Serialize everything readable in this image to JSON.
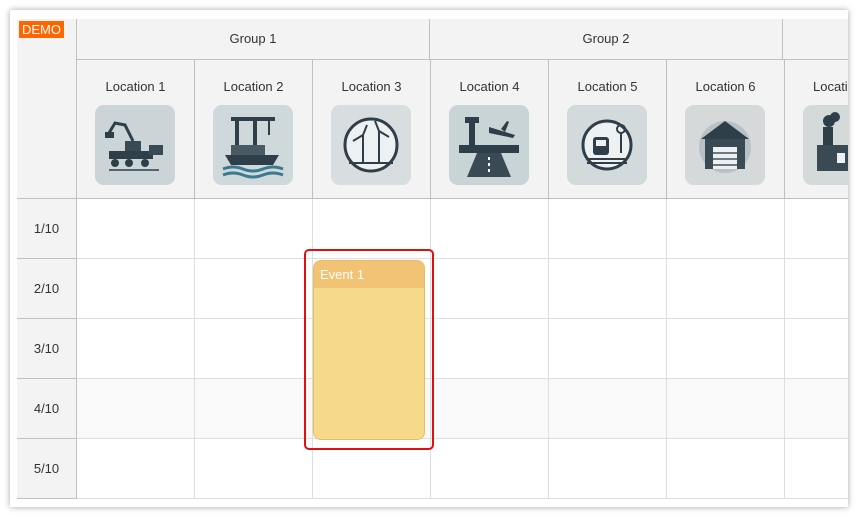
{
  "demo_badge": "DEMO",
  "groups": [
    {
      "name": "Group 1"
    },
    {
      "name": "Group 2"
    }
  ],
  "locations": [
    {
      "name": "Location 1",
      "icon": "excavator-icon"
    },
    {
      "name": "Location 2",
      "icon": "harbor-crane-icon"
    },
    {
      "name": "Location 3",
      "icon": "wind-turbines-icon"
    },
    {
      "name": "Location 4",
      "icon": "airport-icon"
    },
    {
      "name": "Location 5",
      "icon": "train-station-icon"
    },
    {
      "name": "Location 6",
      "icon": "warehouse-icon"
    },
    {
      "name": "Locati",
      "icon": "factory-icon"
    }
  ],
  "rows": [
    "1/10",
    "2/10",
    "3/10",
    "4/10",
    "5/10"
  ],
  "event": {
    "text": "Event 1",
    "resource": "Location 3",
    "start": "2/10",
    "end": "4/10"
  },
  "colors": {
    "event_fill": "#f6d98b",
    "event_bar": "#f2c374",
    "highlight": "#e01010",
    "demo_badge": "#ff6600",
    "header_bg": "#f3f3f3"
  }
}
